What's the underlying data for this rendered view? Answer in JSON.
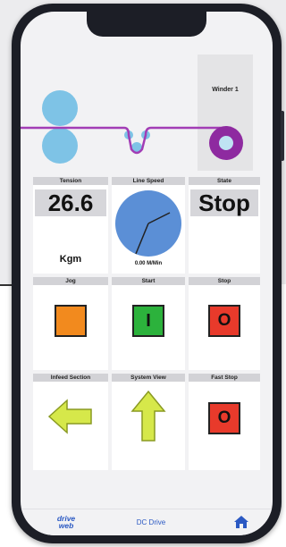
{
  "diagram": {
    "winder_label": "Winder 1",
    "colors": {
      "roll": "#7ec3e6",
      "web": "#a23db5",
      "winder": "#8e2aa0"
    }
  },
  "headers": {
    "tension": "Tension",
    "line_speed": "Line Speed",
    "state": "State",
    "jog": "Jog",
    "start": "Start",
    "stop": "Stop",
    "infeed_section": "Infeed Section",
    "system_view": "System View",
    "fast_stop": "Fast Stop"
  },
  "tension": {
    "value": "26.6",
    "unit": "Kgm"
  },
  "line_speed": {
    "value": "0.00 M/Min"
  },
  "state": {
    "value": "Stop"
  },
  "buttons": {
    "jog": {
      "color": "#f28a1e",
      "icon": "square"
    },
    "start": {
      "glyph": "I",
      "color": "#2cb23c"
    },
    "stop": {
      "glyph": "O",
      "color": "#e83a2b"
    },
    "infeed": {
      "icon": "left-arrow-icon",
      "color": "#d6e84a"
    },
    "system_view": {
      "icon": "up-arrow-icon",
      "color": "#d6e84a"
    },
    "fast_stop": {
      "glyph": "O",
      "color": "#e83a2b"
    }
  },
  "bottom_bar": {
    "logo_line1": "drive",
    "logo_line2": "web",
    "center_label": "DC Drive",
    "home_icon": "home-icon"
  }
}
